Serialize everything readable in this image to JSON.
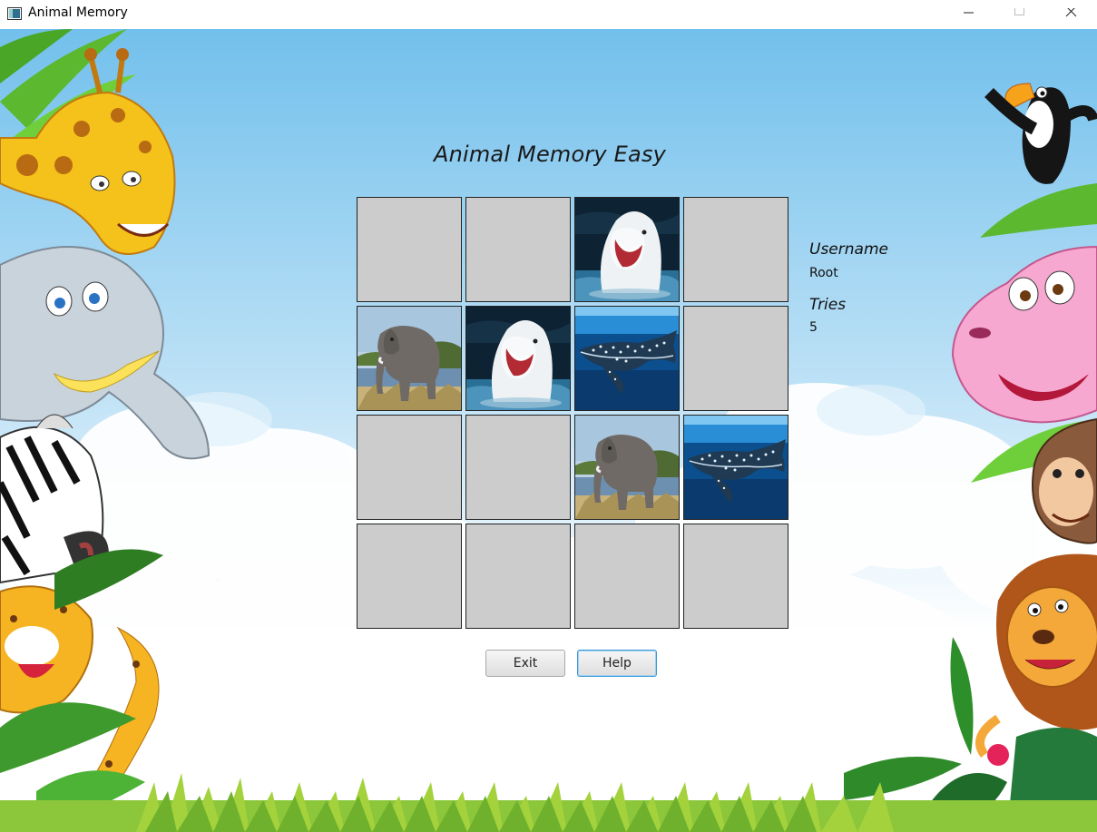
{
  "window": {
    "title": "Animal Memory",
    "controls": [
      "minimize",
      "maximize",
      "close"
    ]
  },
  "game": {
    "title": "Animal Memory Easy",
    "columns": 4,
    "rows": 4,
    "cards": [
      {
        "row": 0,
        "col": 0,
        "state": "hidden",
        "animal": null
      },
      {
        "row": 0,
        "col": 1,
        "state": "hidden",
        "animal": null
      },
      {
        "row": 0,
        "col": 2,
        "state": "revealed",
        "animal": "beluga-whale"
      },
      {
        "row": 0,
        "col": 3,
        "state": "hidden",
        "animal": null
      },
      {
        "row": 1,
        "col": 0,
        "state": "revealed",
        "animal": "elephant"
      },
      {
        "row": 1,
        "col": 1,
        "state": "revealed",
        "animal": "beluga-whale"
      },
      {
        "row": 1,
        "col": 2,
        "state": "revealed",
        "animal": "whale-shark"
      },
      {
        "row": 1,
        "col": 3,
        "state": "hidden",
        "animal": null
      },
      {
        "row": 2,
        "col": 0,
        "state": "hidden",
        "animal": null
      },
      {
        "row": 2,
        "col": 1,
        "state": "hidden",
        "animal": null
      },
      {
        "row": 2,
        "col": 2,
        "state": "revealed",
        "animal": "elephant"
      },
      {
        "row": 2,
        "col": 3,
        "state": "revealed",
        "animal": "whale-shark"
      },
      {
        "row": 3,
        "col": 0,
        "state": "hidden",
        "animal": null
      },
      {
        "row": 3,
        "col": 1,
        "state": "hidden",
        "animal": null
      },
      {
        "row": 3,
        "col": 2,
        "state": "hidden",
        "animal": null
      },
      {
        "row": 3,
        "col": 3,
        "state": "hidden",
        "animal": null
      }
    ]
  },
  "info": {
    "username_label": "Username",
    "username": "Root",
    "tries_label": "Tries",
    "tries": "5"
  },
  "buttons": {
    "exit": "Exit",
    "help": "Help"
  },
  "colors": {
    "card_back": "#cccccc",
    "sky_top": "#7cc4ec",
    "sky_bottom": "#ffffff",
    "focus": "#3c9ad8"
  },
  "background_characters": [
    "giraffe",
    "elephant",
    "zebra",
    "leopard",
    "toucan",
    "hippo",
    "monkey",
    "lion",
    "grass",
    "palm-leaves",
    "clouds"
  ]
}
